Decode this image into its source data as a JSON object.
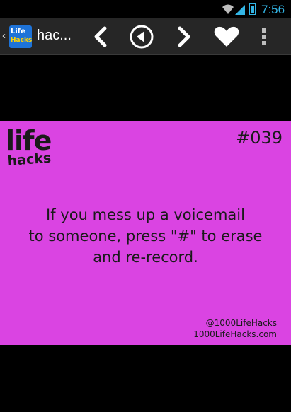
{
  "status_bar": {
    "time": "7:56",
    "icons": [
      "wifi-icon",
      "signal-icon",
      "battery-icon"
    ],
    "accent_color": "#33b5e5"
  },
  "action_bar": {
    "app_logo_lines": [
      "Life",
      "Hacks"
    ],
    "title": "hac...",
    "buttons": [
      "previous",
      "play",
      "next",
      "favorite",
      "overflow-menu"
    ]
  },
  "card": {
    "background_color": "#da44e2",
    "brand_life": "life",
    "brand_hacks": "hacks",
    "number": "#039",
    "hack_lines": [
      "If you mess up a voicemail",
      "to someone, press \"#\" to erase",
      "and re-record."
    ],
    "handle": "@1000LifeHacks",
    "website": "1000LifeHacks.com"
  }
}
